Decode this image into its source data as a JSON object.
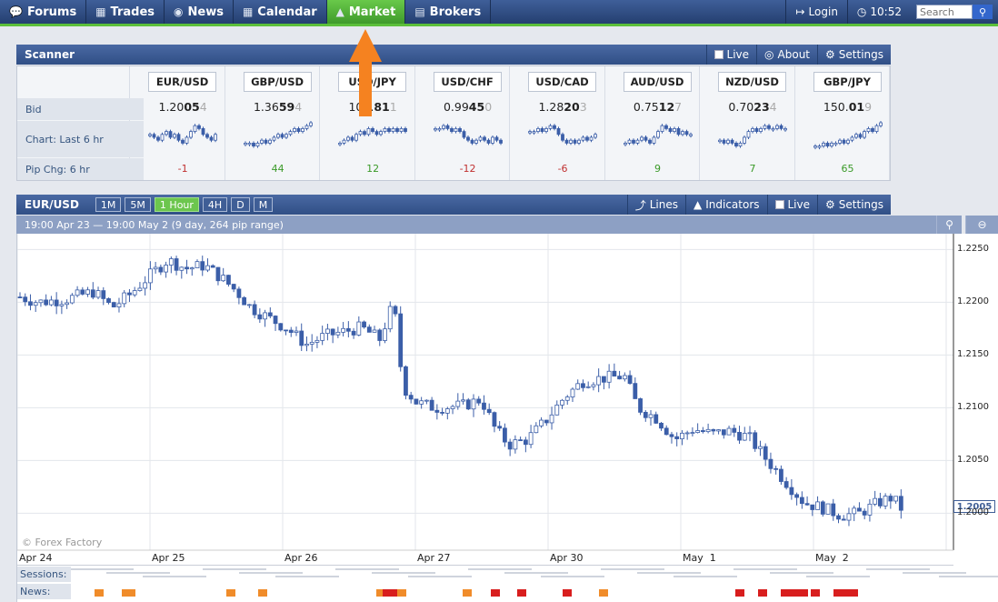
{
  "nav": {
    "tabs": [
      {
        "label": "Forums",
        "icon": "chat-icon"
      },
      {
        "label": "Trades",
        "icon": "trades-chart-icon"
      },
      {
        "label": "News",
        "icon": "globe-icon"
      },
      {
        "label": "Calendar",
        "icon": "calendar-icon"
      },
      {
        "label": "Market",
        "icon": "market-chart-icon",
        "active": true
      },
      {
        "label": "Brokers",
        "icon": "brokers-icon"
      }
    ],
    "login_label": "Login",
    "time": "10:52",
    "search_placeholder": "Search"
  },
  "scanner": {
    "title": "Scanner",
    "live_label": "Live",
    "about_label": "About",
    "settings_label": "Settings",
    "row_labels": {
      "bid": "Bid",
      "chart": "Chart: Last 6 hr",
      "pip": "Pip Chg: 6 hr"
    },
    "pairs": [
      {
        "name": "EUR/USD",
        "bid_pre": "1.20",
        "bid_big": "05",
        "bid_last": "4",
        "pip": "-1",
        "dir": "neg",
        "trend": [
          6,
          5,
          4,
          6,
          7,
          5,
          6,
          4,
          3,
          5,
          7,
          9,
          8,
          6,
          5,
          4,
          6
        ]
      },
      {
        "name": "GBP/USD",
        "bid_pre": "1.36",
        "bid_big": "59",
        "bid_last": "4",
        "pip": "44",
        "dir": "pos",
        "trend": [
          3,
          3,
          2,
          3,
          4,
          3,
          4,
          5,
          6,
          5,
          6,
          7,
          8,
          7,
          8,
          9,
          10
        ]
      },
      {
        "name": "USD/JPY",
        "bid_pre": "109.",
        "bid_big": "81",
        "bid_last": "1",
        "pip": "12",
        "dir": "pos",
        "trend": [
          3,
          4,
          5,
          4,
          6,
          7,
          6,
          8,
          7,
          6,
          7,
          8,
          7,
          8,
          7,
          8,
          7
        ]
      },
      {
        "name": "USD/CHF",
        "bid_pre": "0.99",
        "bid_big": "45",
        "bid_last": "0",
        "pip": "-12",
        "dir": "neg",
        "trend": [
          8,
          8,
          9,
          8,
          7,
          8,
          7,
          5,
          4,
          3,
          4,
          5,
          4,
          3,
          5,
          4,
          3
        ]
      },
      {
        "name": "USD/CAD",
        "bid_pre": "1.28",
        "bid_big": "20",
        "bid_last": "3",
        "pip": "-6",
        "dir": "neg",
        "trend": [
          7,
          7,
          8,
          7,
          8,
          9,
          8,
          6,
          4,
          3,
          4,
          3,
          4,
          5,
          4,
          5,
          6
        ]
      },
      {
        "name": "AUD/USD",
        "bid_pre": "0.75",
        "bid_big": "12",
        "bid_last": "7",
        "pip": "9",
        "dir": "pos",
        "trend": [
          3,
          4,
          3,
          4,
          5,
          4,
          3,
          5,
          7,
          9,
          8,
          7,
          8,
          6,
          7,
          6,
          6
        ]
      },
      {
        "name": "NZD/USD",
        "bid_pre": "0.70",
        "bid_big": "23",
        "bid_last": "4",
        "pip": "7",
        "dir": "pos",
        "trend": [
          4,
          3,
          4,
          3,
          2,
          3,
          5,
          7,
          8,
          7,
          8,
          9,
          8,
          8,
          9,
          8,
          8
        ]
      },
      {
        "name": "GBP/JPY",
        "bid_pre": "150.",
        "bid_big": "01",
        "bid_last": "9",
        "pip": "65",
        "dir": "pos",
        "trend": [
          2,
          2,
          3,
          2,
          3,
          3,
          4,
          3,
          4,
          5,
          6,
          5,
          7,
          8,
          7,
          9,
          10
        ]
      }
    ]
  },
  "chart_panel": {
    "pair": "EUR/USD",
    "timeframes": [
      "1M",
      "5M",
      "1 Hour",
      "4H",
      "D",
      "M"
    ],
    "active_timeframe": "1 Hour",
    "lines_label": "Lines",
    "indicators_label": "Indicators",
    "live_label": "Live",
    "settings_label": "Settings",
    "range_text": "19:00 Apr 23 — 19:00 May 2 (9 day, 264 pip range)",
    "watermark": "© Forex Factory",
    "last_price": "1.2005",
    "sessions_label": "Sessions:",
    "news_label": "News:"
  },
  "chart_data": {
    "type": "candlestick",
    "y_ticks": [
      "1.2250",
      "1.2200",
      "1.2150",
      "1.2100",
      "1.2050",
      "1.2000"
    ],
    "ylim": [
      1.1965,
      1.2265
    ],
    "x_ticks": [
      "Apr 24",
      "Apr 25",
      "Apr 26",
      "Apr 27",
      "Apr 30",
      "May  1",
      "May  2"
    ],
    "close_path": [
      [
        0,
        1.2205
      ],
      [
        0.02,
        1.22
      ],
      [
        0.05,
        1.2203
      ],
      [
        0.08,
        1.221
      ],
      [
        0.1,
        1.2195
      ],
      [
        0.12,
        1.2208
      ],
      [
        0.14,
        1.2225
      ],
      [
        0.16,
        1.224
      ],
      [
        0.18,
        1.2232
      ],
      [
        0.2,
        1.2235
      ],
      [
        0.22,
        1.2222
      ],
      [
        0.235,
        1.221
      ],
      [
        0.25,
        1.2195
      ],
      [
        0.27,
        1.2185
      ],
      [
        0.29,
        1.2175
      ],
      [
        0.31,
        1.216
      ],
      [
        0.33,
        1.2168
      ],
      [
        0.35,
        1.2172
      ],
      [
        0.37,
        1.2176
      ],
      [
        0.39,
        1.2165
      ],
      [
        0.405,
        1.22
      ],
      [
        0.415,
        1.212
      ],
      [
        0.43,
        1.2105
      ],
      [
        0.45,
        1.21
      ],
      [
        0.48,
        1.2102
      ],
      [
        0.5,
        1.2108
      ],
      [
        0.515,
        1.208
      ],
      [
        0.53,
        1.2065
      ],
      [
        0.55,
        1.207
      ],
      [
        0.57,
        1.2088
      ],
      [
        0.59,
        1.211
      ],
      [
        0.61,
        1.2125
      ],
      [
        0.63,
        1.2128
      ],
      [
        0.655,
        1.213
      ],
      [
        0.67,
        1.21
      ],
      [
        0.69,
        1.209
      ],
      [
        0.71,
        1.207
      ],
      [
        0.73,
        1.208
      ],
      [
        0.75,
        1.2075
      ],
      [
        0.77,
        1.2078
      ],
      [
        0.79,
        1.2072
      ],
      [
        0.81,
        1.205
      ],
      [
        0.83,
        1.203
      ],
      [
        0.85,
        1.201
      ],
      [
        0.87,
        1.2005
      ],
      [
        0.89,
        1.1998
      ],
      [
        0.91,
        1.2
      ],
      [
        0.93,
        1.201
      ],
      [
        0.945,
        1.2015
      ],
      [
        0.955,
        1.2005
      ]
    ]
  }
}
